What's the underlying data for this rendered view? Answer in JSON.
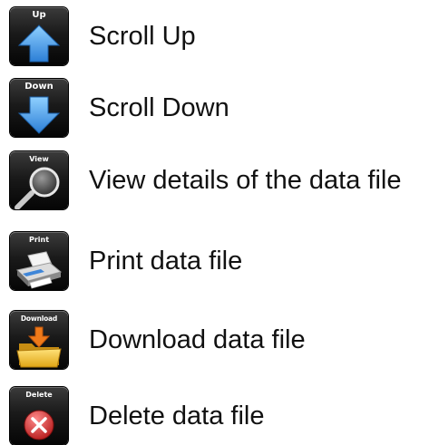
{
  "items": [
    {
      "button_caption": "Up",
      "icon": "arrow-up-icon",
      "label": "Scroll Up"
    },
    {
      "button_caption": "Down",
      "icon": "arrow-down-icon",
      "label": "Scroll Down"
    },
    {
      "button_caption": "View",
      "icon": "magnifier-icon",
      "label": "View details of the data file"
    },
    {
      "button_caption": "Print",
      "icon": "printer-icon",
      "label": "Print data file"
    },
    {
      "button_caption": "Download",
      "icon": "folder-download-icon",
      "label": "Download data file"
    },
    {
      "button_caption": "Delete",
      "icon": "delete-x-icon",
      "label": "Delete data file"
    }
  ],
  "colors": {
    "button_background": "#111111",
    "arrow_blue": "#3f9be6",
    "folder_yellow": "#f2c230",
    "download_orange": "#ef7a1a",
    "delete_red": "#d32a2a"
  }
}
